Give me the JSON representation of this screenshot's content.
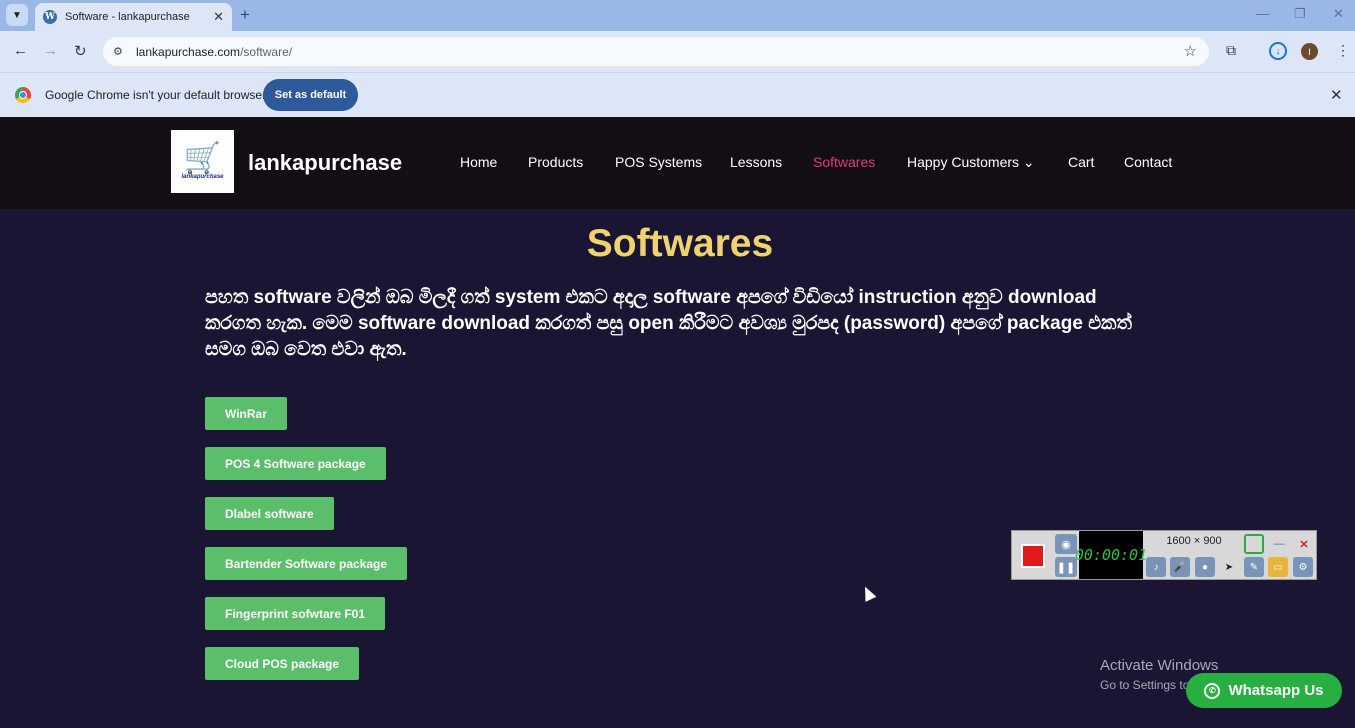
{
  "browser": {
    "tab_title": "Software - lankapurchase",
    "tab_favicon": "W",
    "tab_close": "✕",
    "new_tab": "+",
    "url_host": "lankapurchase.com",
    "url_path": "/software/",
    "icons": {
      "tab_menu": "chevron-down-icon",
      "back": "back-arrow-icon",
      "forward": "forward-arrow-icon",
      "reload": "reload-icon",
      "site_info": "site-settings-icon",
      "bookmark": "star-icon",
      "extensions": "puzzle-icon",
      "download": "download-icon",
      "menu": "kebab-menu-icon"
    },
    "avatar_letter": "I"
  },
  "infobar": {
    "message": "Google Chrome isn't your default browser",
    "set_default_label": "Set as default",
    "close": "✕"
  },
  "site": {
    "brand": "lankapurchase",
    "logo_text": "lankapurchase",
    "nav": [
      {
        "label": "Home"
      },
      {
        "label": "Products"
      },
      {
        "label": "POS Systems"
      },
      {
        "label": "Lessons"
      },
      {
        "label": "Softwares",
        "active": true
      },
      {
        "label": "Happy Customers ⌄"
      },
      {
        "label": "Cart"
      },
      {
        "label": "Contact"
      }
    ],
    "active_color": "#e23a72",
    "accent_title_color": "#efd36e",
    "button_color": "#5bbe6b"
  },
  "main": {
    "title": "Softwares",
    "intro": "පහත software වලින් ඔබ මිලදී ගත් system එකට අදාල software අපගේ විඩියෝ instruction අනුව download කරගත හැක. මෙම software download කරගත් පසු open කිරීමට අවශ්‍ය මුරපද (password) අපගේ package එකත් සමග ඔබ වෙත එවා ඇත.",
    "downloads": [
      {
        "label": "WinRar"
      },
      {
        "label": "POS 4 Software package"
      },
      {
        "label": "Dlabel software"
      },
      {
        "label": "Bartender Software package"
      },
      {
        "label": "Fingerprint sofwtare F01"
      },
      {
        "label": "Cloud POS package"
      }
    ]
  },
  "recorder": {
    "timer": "00:00:01",
    "resolution": "1600 × 900"
  },
  "os_watermark": {
    "line1": "Activate Windows",
    "line2": "Go to Settings to activate Windows."
  },
  "whatsapp": {
    "label": "Whatsapp Us"
  }
}
